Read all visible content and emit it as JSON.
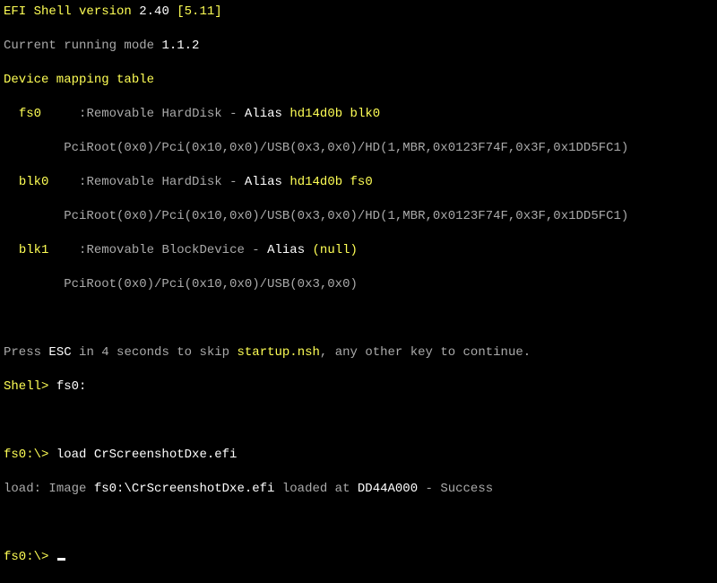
{
  "header": {
    "title_prefix": "EFI Shell version ",
    "version": "2.40",
    "bracket": " [5.11]",
    "mode_label": "Current running mode ",
    "mode_value": "1.1.2",
    "table_label": "Device mapping table"
  },
  "devices": {
    "fs0": {
      "name": "fs0",
      "sep1": "     :",
      "type": "Removable HardDisk",
      "dash": " - ",
      "alias_word": "Alias ",
      "alias_val": "hd14d0b blk0",
      "path_prefix": "        ",
      "path": "PciRoot(0x0)/Pci(0x10,0x0)/USB(0x3,0x0)/HD(1,MBR,0x0123F74F,0x3F,0x1DD5FC1)"
    },
    "blk0": {
      "name": "blk0",
      "sep1": "    :",
      "type": "Removable HardDisk",
      "dash": " - ",
      "alias_word": "Alias ",
      "alias_val": "hd14d0b fs0",
      "path_prefix": "        ",
      "path": "PciRoot(0x0)/Pci(0x10,0x0)/USB(0x3,0x0)/HD(1,MBR,0x0123F74F,0x3F,0x1DD5FC1)"
    },
    "blk1": {
      "name": "blk1",
      "sep1": "    :",
      "type": "Removable BlockDevice",
      "dash": " - ",
      "alias_word": "Alias ",
      "alias_val": "(null)",
      "path_prefix": "        ",
      "path": "PciRoot(0x0)/Pci(0x10,0x0)/USB(0x3,0x0)"
    }
  },
  "press": {
    "p1": "Press ",
    "esc": "ESC",
    "p2": " in 4 seconds to skip ",
    "file": "startup.nsh",
    "p3": ", any other key to continue."
  },
  "shell": {
    "prompt1": "Shell> ",
    "cmd1": "fs0:",
    "prompt2": "fs0:\\> ",
    "cmd2": "load CrScreenshotDxe.efi",
    "load_label": "load:",
    "load_p1": " Image ",
    "load_img": "fs0:\\CrScreenshotDxe.efi",
    "load_p2": " loaded at ",
    "load_addr": "DD44A000",
    "load_p3": " - Success",
    "prompt3": "fs0:\\> "
  },
  "indent2": "  "
}
